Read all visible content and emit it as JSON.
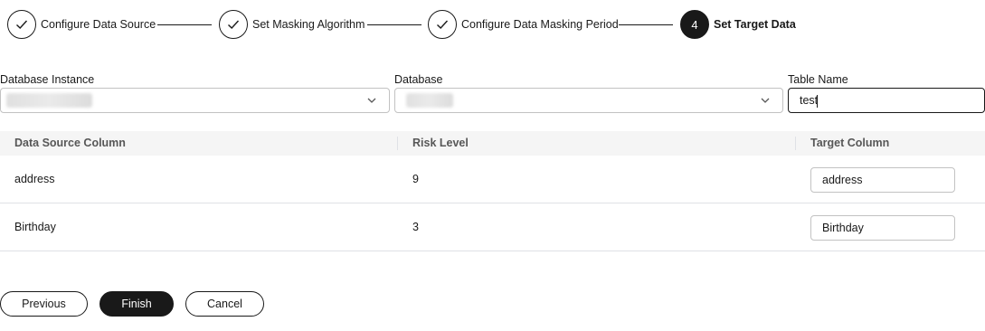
{
  "stepper": {
    "steps": [
      {
        "label": "Configure Data Source",
        "status": "completed"
      },
      {
        "label": "Set Masking Algorithm",
        "status": "completed"
      },
      {
        "label": "Configure Data Masking Period",
        "status": "completed"
      },
      {
        "label": "Set Target Data",
        "status": "active",
        "number": "4"
      }
    ]
  },
  "form": {
    "database_instance": {
      "label": "Database Instance",
      "value": ""
    },
    "database": {
      "label": "Database",
      "value": ""
    },
    "table_name": {
      "label": "Table Name",
      "value": "test"
    }
  },
  "table": {
    "columns": [
      "Data Source Column",
      "Risk Level",
      "Target Column"
    ],
    "rows": [
      {
        "source": "address",
        "risk": "9",
        "target": "address"
      },
      {
        "source": "Birthday",
        "risk": "3",
        "target": "Birthday"
      }
    ]
  },
  "buttons": {
    "previous": "Previous",
    "finish": "Finish",
    "cancel": "Cancel"
  }
}
